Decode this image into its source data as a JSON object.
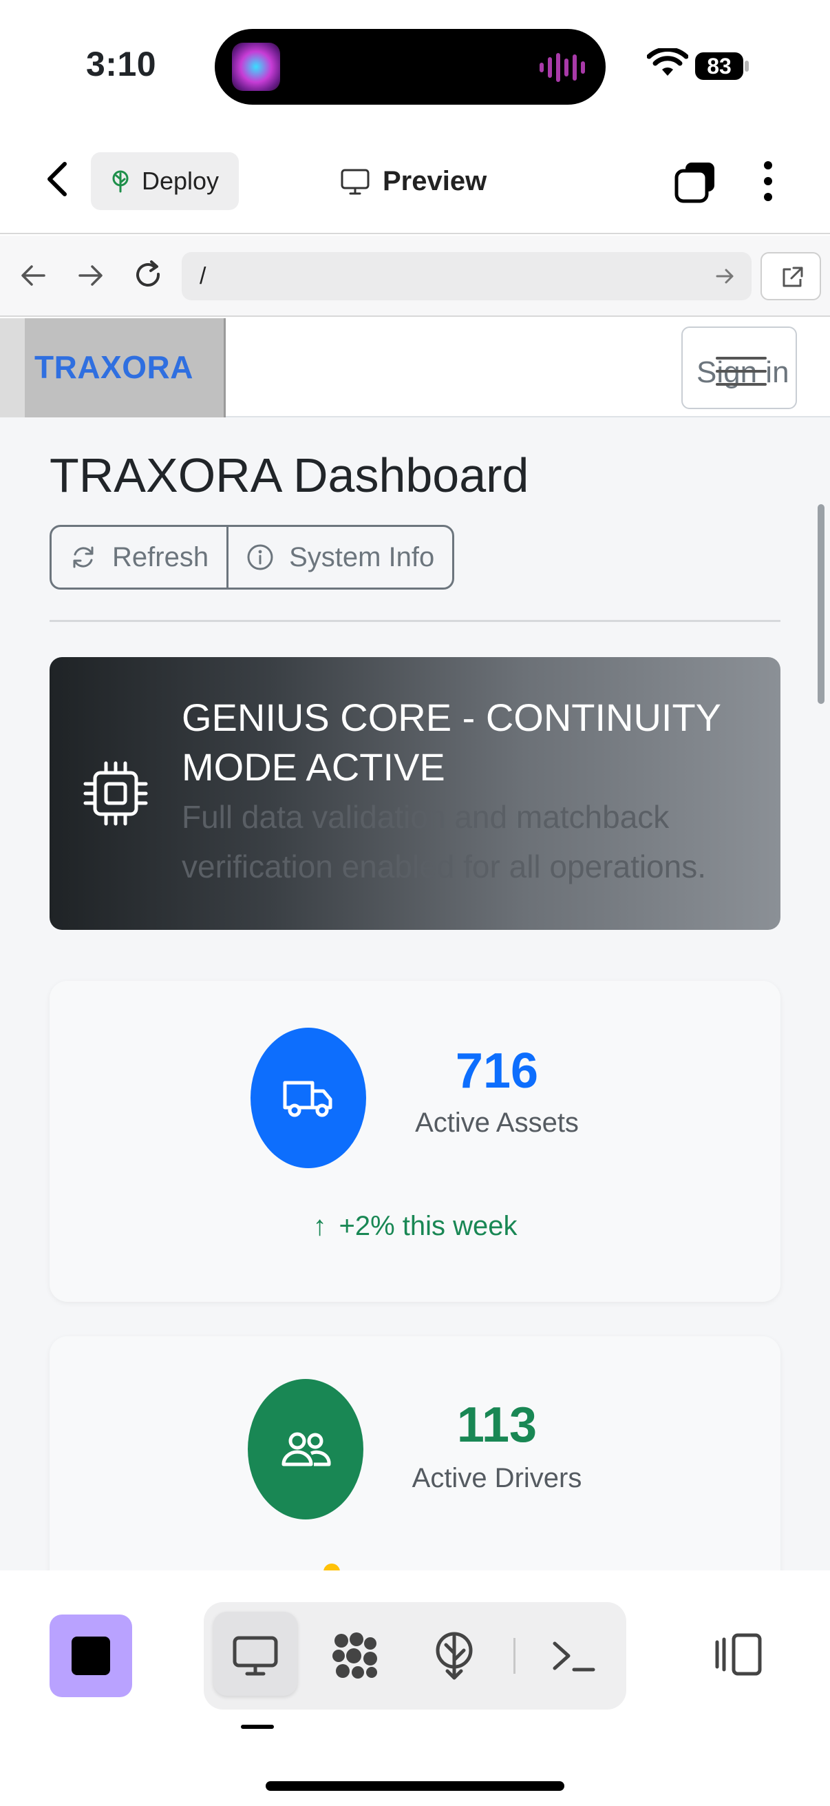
{
  "status_bar": {
    "time": "3:10",
    "battery": "83"
  },
  "app_header": {
    "deploy_label": "Deploy",
    "preview_label": "Preview"
  },
  "browser": {
    "url": "/"
  },
  "site_nav": {
    "brand": "TRAXORA",
    "sign_in_label": "Sign in"
  },
  "dashboard": {
    "title": "TRAXORA Dashboard",
    "buttons": {
      "refresh": "Refresh",
      "system_info": "System Info"
    },
    "banner": {
      "title": "GENIUS CORE - CONTINUITY MODE ACTIVE",
      "text": "Full data validation and matchback verification enabled for all operations."
    },
    "stats": [
      {
        "value": "716",
        "label": "Active Assets",
        "delta": "+2% this week",
        "delta_arrow": "↑",
        "color": "#0d6efd",
        "icon": "truck-icon"
      },
      {
        "value": "113",
        "label": "Active Drivers",
        "color": "#198754",
        "icon": "people-icon"
      }
    ]
  },
  "toolbar": {
    "icons": [
      "stop-icon",
      "desktop-icon",
      "cluster-icon",
      "deploy-icon",
      "terminal-icon",
      "sidebar-icon"
    ]
  }
}
